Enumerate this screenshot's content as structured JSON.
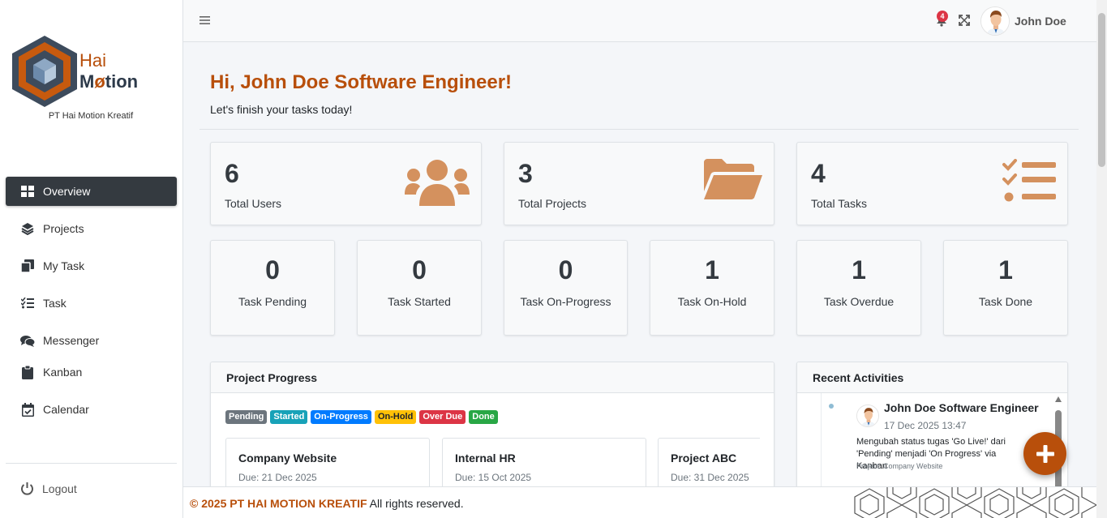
{
  "brand": {
    "line1": "Hai",
    "line2_prefix": "M",
    "line2_o": "ø",
    "line2_suffix": "tion",
    "company": "PT Hai Motion Kreatif"
  },
  "sidebar": {
    "items": [
      {
        "label": "Overview",
        "icon": "grid-icon",
        "active": true
      },
      {
        "label": "Projects",
        "icon": "layers-icon"
      },
      {
        "label": "My Task",
        "icon": "clone-icon"
      },
      {
        "label": "Task",
        "icon": "list-check-icon"
      },
      {
        "label": "Messenger",
        "icon": "comments-icon"
      },
      {
        "label": "Kanban",
        "icon": "clipboard-icon"
      },
      {
        "label": "Calendar",
        "icon": "calendar-check-icon"
      }
    ],
    "logout": "Logout"
  },
  "header": {
    "notification_count": "4",
    "user_name": "John Doe"
  },
  "main": {
    "greeting": "Hi, John Doe Software Engineer!",
    "subtitle": "Let's finish your tasks today!",
    "summary": [
      {
        "value": "6",
        "label": "Total Users",
        "icon": "users-icon"
      },
      {
        "value": "3",
        "label": "Total Projects",
        "icon": "folder-open-icon"
      },
      {
        "value": "4",
        "label": "Total Tasks",
        "icon": "tasks-icon"
      }
    ],
    "status": [
      {
        "value": "0",
        "label": "Task Pending"
      },
      {
        "value": "0",
        "label": "Task Started"
      },
      {
        "value": "0",
        "label": "Task On-Progress"
      },
      {
        "value": "1",
        "label": "Task On-Hold"
      },
      {
        "value": "1",
        "label": "Task Overdue"
      },
      {
        "value": "1",
        "label": "Task Done"
      }
    ],
    "project_progress": {
      "title": "Project Progress",
      "legend": [
        {
          "label": "Pending",
          "color": "#6c757d"
        },
        {
          "label": "Started",
          "color": "#17a2b8"
        },
        {
          "label": "On-Progress",
          "color": "#007bff"
        },
        {
          "label": "On-Hold",
          "color": "#ffc107"
        },
        {
          "label": "Over Due",
          "color": "#dc3545"
        },
        {
          "label": "Done",
          "color": "#28a745"
        }
      ],
      "projects": [
        {
          "name": "Company Website",
          "due": "Due: 21 Dec 2025"
        },
        {
          "name": "Internal HR",
          "due": "Due: 15 Oct 2025"
        },
        {
          "name": "Project ABC",
          "due": "Due: 31 Dec 2025"
        }
      ]
    },
    "recent_activities": {
      "title": "Recent Activities",
      "items": [
        {
          "user": "John Doe Software Engineer",
          "time": "17 Dec 2025 13:47",
          "text": "Mengubah status tugas 'Go Live!' dari 'Pending' menjadi 'On Progress' via Kanban",
          "project": "Project: Company Website"
        }
      ]
    }
  },
  "footer": {
    "copyright": "© 2025 PT HAI MOTION KREATIF",
    "rights": " All rights reserved."
  },
  "colors": {
    "accent": "#b84f0b",
    "icon": "#d4915e",
    "dark": "#343a40"
  }
}
